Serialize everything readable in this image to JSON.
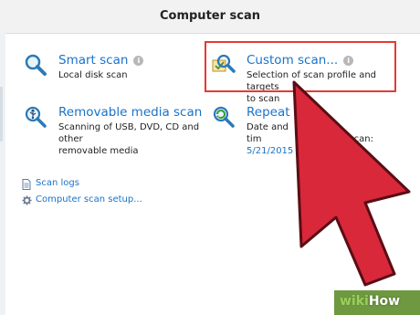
{
  "window": {
    "title": "Computer scan"
  },
  "scan_options": {
    "smart": {
      "title": "Smart scan",
      "desc": [
        "Local disk scan"
      ]
    },
    "custom": {
      "title": "Custom scan...",
      "desc": [
        "Selection of scan profile and targets",
        "to scan"
      ]
    },
    "removable": {
      "title": "Removable media scan",
      "desc": [
        "Scanning of USB, DVD, CD and other",
        "removable media"
      ]
    },
    "repeat": {
      "title": "Repeat la",
      "desc": [
        "Date and tim",
        "5/21/2015 6"
      ],
      "desc_suffix": "scan:"
    }
  },
  "links": {
    "scan_logs": "Scan logs",
    "setup": "Computer scan setup..."
  },
  "watermark": {
    "wiki": "wiki",
    "how": "How"
  },
  "colors": {
    "link": "#1a73c9",
    "highlight": "#e53935",
    "arrow": "#d8283a",
    "watermark_bg": "#669337"
  },
  "icons": {
    "smart": "magnifier-icon",
    "custom": "magnifier-check-icon",
    "removable": "usb-icon",
    "repeat": "repeat-scan-icon",
    "info": "info-icon",
    "logs": "document-icon",
    "setup": "gear-icon"
  }
}
